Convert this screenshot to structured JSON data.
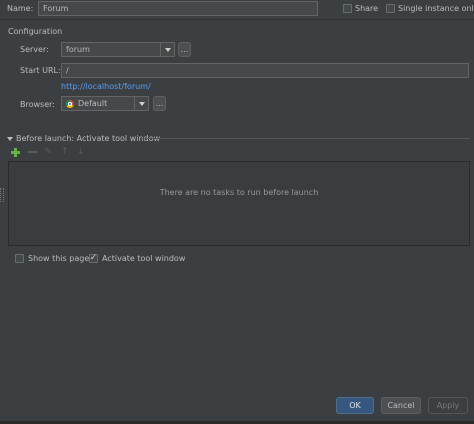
{
  "name": {
    "label": "Name:",
    "value": "Forum"
  },
  "share": {
    "label": "Share"
  },
  "single_instance": {
    "label": "Single instance only"
  },
  "configuration": {
    "title": "Configuration",
    "server": {
      "label": "Server:",
      "value": "forum",
      "more": "..."
    },
    "start_url": {
      "label": "Start URL:",
      "value": "/",
      "link": "http://localhost/forum/"
    },
    "browser": {
      "label": "Browser:",
      "value": "Default",
      "more": "..."
    }
  },
  "before_launch": {
    "title": "Before launch: Activate tool window",
    "empty_text": "There are no tasks to run before launch"
  },
  "show_this_page": {
    "label": "Show this page",
    "checked": false
  },
  "activate_tool_window": {
    "label": "Activate tool window",
    "checked": true
  },
  "buttons": {
    "ok": "OK",
    "cancel": "Cancel",
    "apply": "Apply"
  },
  "colors": {
    "background": "#3c3f41",
    "link": "#589df6",
    "ok": "#365880",
    "add_icon": "#62b543"
  },
  "icons": {
    "add": "plus-icon",
    "remove": "minus-icon",
    "edit": "pencil-icon",
    "up": "arrow-up-icon",
    "down": "arrow-down-icon",
    "browser": "chrome-icon"
  }
}
